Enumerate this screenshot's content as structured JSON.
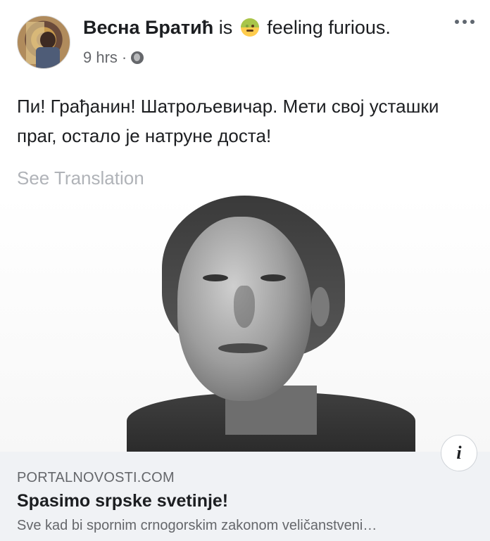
{
  "post": {
    "author": "Весна Братић",
    "is_text": "is",
    "feeling_text": "feeling furious.",
    "time": "9 hrs",
    "separator": "·",
    "body": "Пи! Грађанин! Шатрољевичар. Мети свој усташки праг, остало је натруне доста!",
    "see_translation": "See Translation"
  },
  "icons": {
    "emoji": "furious-face-icon",
    "privacy": "globe-icon",
    "more": "more-options-icon",
    "info": "info-icon"
  },
  "link": {
    "domain": "PORTALNOVOSTI.COM",
    "title": "Spasimo srpske svetinje!",
    "description": "Sve kad bi spornim crnogorskim zakonom veličanstveni…",
    "info_glyph": "i"
  },
  "colors": {
    "text_primary": "#1c1e21",
    "text_secondary": "#65676b",
    "translation": "#b0b3b8",
    "link_box_bg": "#f0f2f5",
    "emoji_yellow": "#ffcc4d"
  }
}
